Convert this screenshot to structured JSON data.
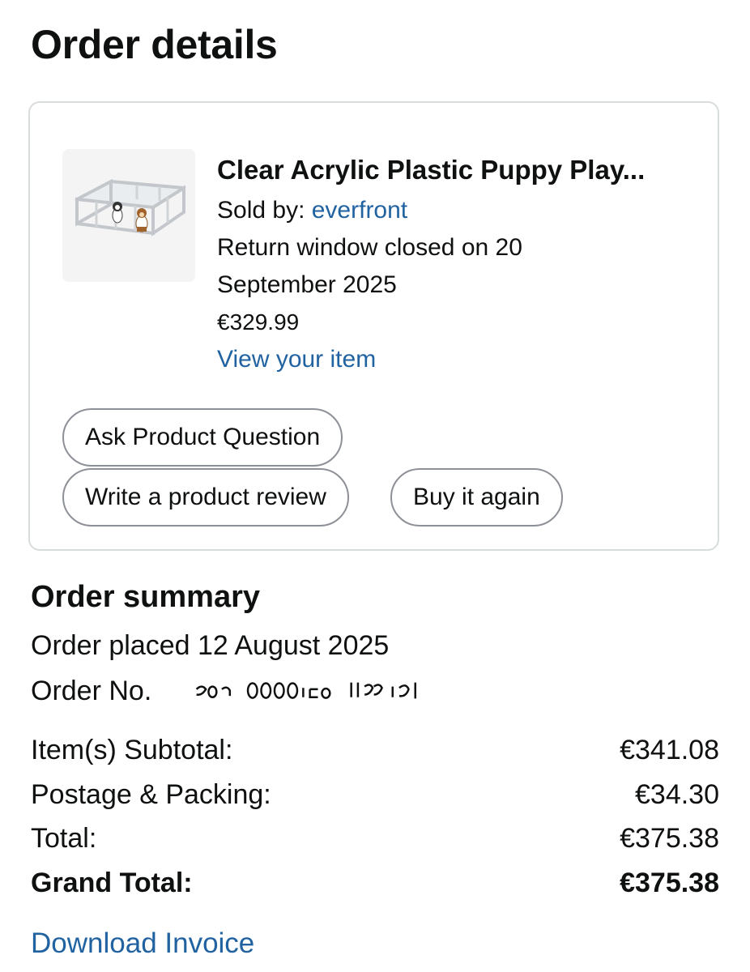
{
  "page": {
    "title": "Order details"
  },
  "item": {
    "title": "Clear Acrylic Plastic Puppy Play...",
    "sold_by_prefix": "Sold by:",
    "seller": "everfront",
    "return_line1": "Return window closed on 20",
    "return_line2": "September 2025",
    "price": "€329.99",
    "view_link": "View your item",
    "image_icon": "product-image-playpen"
  },
  "actions": {
    "ask": "Ask Product Question",
    "review": "Write a product review",
    "buy_again": "Buy it again"
  },
  "summary": {
    "heading": "Order summary",
    "placed": "Order placed 12 August 2025",
    "order_no_label": "Order No."
  },
  "totals": [
    {
      "label": "Item(s) Subtotal:",
      "value": "€341.08"
    },
    {
      "label": "Postage & Packing:",
      "value": "€34.30"
    },
    {
      "label": "Total:",
      "value": "€375.38"
    },
    {
      "label": "Grand Total:",
      "value": "€375.38"
    }
  ],
  "invoice": {
    "link": "Download Invoice"
  },
  "colors": {
    "link": "#2162a1",
    "text": "#0f1111",
    "card_border": "#d9dcdc",
    "pill_border": "#8d9096"
  }
}
